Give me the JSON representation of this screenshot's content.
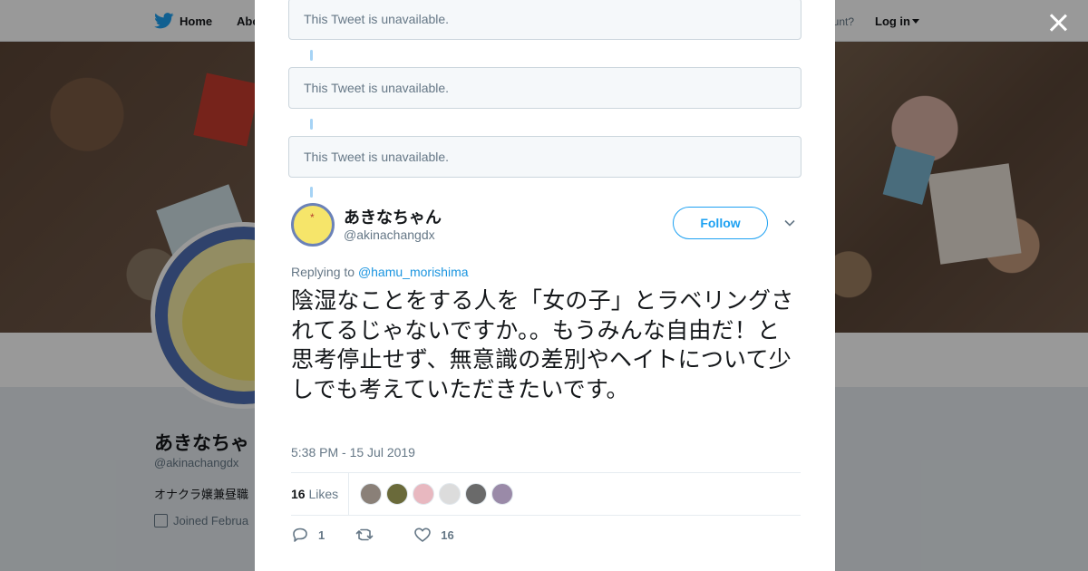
{
  "nav": {
    "home_label": "Home",
    "about_label": "Abo",
    "have_account_text": "ccount?",
    "login_label": "Log in"
  },
  "profile": {
    "name": "あきなちゃ",
    "handle": "@akinachangdx",
    "bio": "オナクラ嬢兼昼職",
    "joined": "Joined Februa"
  },
  "modal": {
    "unavailable_tweets": [
      "This Tweet is unavailable.",
      "This Tweet is unavailable.",
      "This Tweet is unavailable."
    ],
    "tweet": {
      "display_name": "あきなちゃん",
      "handle": "@akinachangdx",
      "follow_label": "Follow",
      "replying_prefix": "Replying to",
      "replying_to": "@hamu_morishima",
      "text": "陰湿なことをする人を「女の子」とラベリングされてるじゃないですか。。もうみんな自由だ！と思考停止せず、無意識の差別やヘイトについて少しでも考えていただきたいです。",
      "timestamp": "5:38 PM - 15 Jul 2019",
      "likes_count": "16",
      "likes_label": "Likes",
      "liker_colors": [
        "#8a8078",
        "#6a6a3a",
        "#e8b8c0",
        "#dcdcdc",
        "#6a6a6a",
        "#9a8aa8"
      ],
      "reply_count": "1",
      "retweet_count": "",
      "like_count": "16"
    }
  },
  "colors": {
    "accent": "#1da1f2",
    "link": "#1b95e0",
    "muted": "#657786",
    "overlay": "rgba(0,0,0,0.40)"
  },
  "icons": [
    "twitter-bird-icon",
    "close-icon",
    "chevron-down-icon",
    "reply-icon",
    "retweet-icon",
    "heart-icon",
    "calendar-icon"
  ]
}
